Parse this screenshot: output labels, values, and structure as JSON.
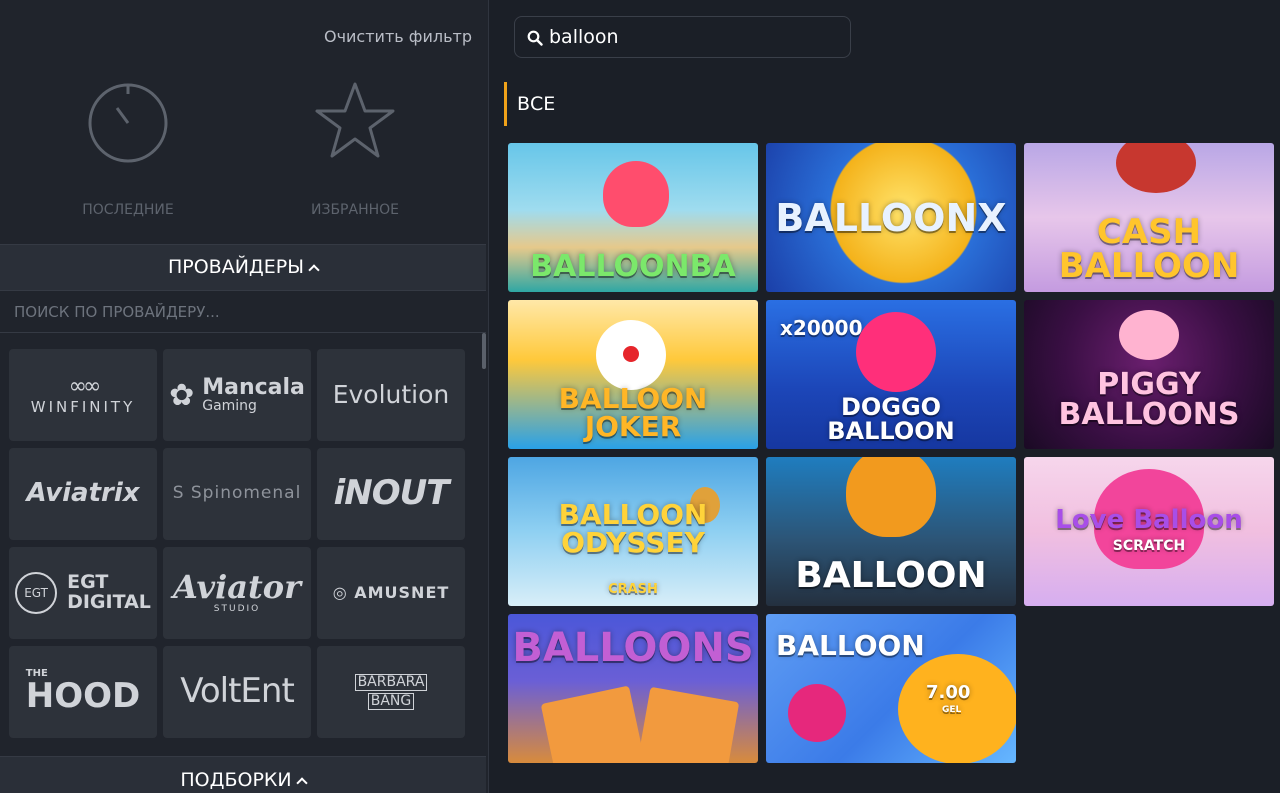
{
  "filters": {
    "clear_label": "Очистить фильтр",
    "recent_label": "ПОСЛЕДНИЕ",
    "favorites_label": "ИЗБРАННОЕ"
  },
  "providers": {
    "header_label": "ПРОВАЙДЕРЫ",
    "search_placeholder": "ПОИСК ПО ПРОВАЙДЕРУ...",
    "items": [
      {
        "name": "WINFINITY",
        "logo": "∞∞"
      },
      {
        "name": "Mancala",
        "sub": "Gaming",
        "logo": "✿"
      },
      {
        "name": "Evolution"
      },
      {
        "name": "Aviatrix"
      },
      {
        "name": "Spinomenal",
        "logo": "S"
      },
      {
        "name": "iNOUT"
      },
      {
        "name": "EGT",
        "sub": "DIGITAL",
        "logo": "EGT"
      },
      {
        "name": "Aviator",
        "sub": "STUDIO"
      },
      {
        "name": "AMUSNET",
        "logo": "◎"
      },
      {
        "name": "HOOD",
        "sub": "THE"
      },
      {
        "name": "VoltEnt"
      },
      {
        "name": "BARBARA",
        "sub": "BANG"
      }
    ]
  },
  "collections": {
    "header_label": "ПОДБОРКИ"
  },
  "search": {
    "value": "balloon"
  },
  "category": {
    "label": "ВСЕ"
  },
  "games": [
    {
      "title": "BALLOONBA"
    },
    {
      "title": "BALLOONX"
    },
    {
      "title": "CASH BALLOON"
    },
    {
      "title": "BALLOON JOKER"
    },
    {
      "title": "DOGGO BALLOON",
      "badge": "x20000"
    },
    {
      "title": "PIGGY BALLOONS"
    },
    {
      "title": "BALLOON ODYSSEY",
      "sub": "CRASH"
    },
    {
      "title": "BALLOON"
    },
    {
      "title": "Love Balloon",
      "sub": "SCRATCH"
    },
    {
      "title": "BALLOONS"
    },
    {
      "title": "BALLOON",
      "amount": "7.00",
      "currency": "GEL"
    }
  ],
  "colors": {
    "accent": "#f0a21a",
    "background": "#1b1f27",
    "panel": "#20242c",
    "tile": "#2d323a"
  }
}
